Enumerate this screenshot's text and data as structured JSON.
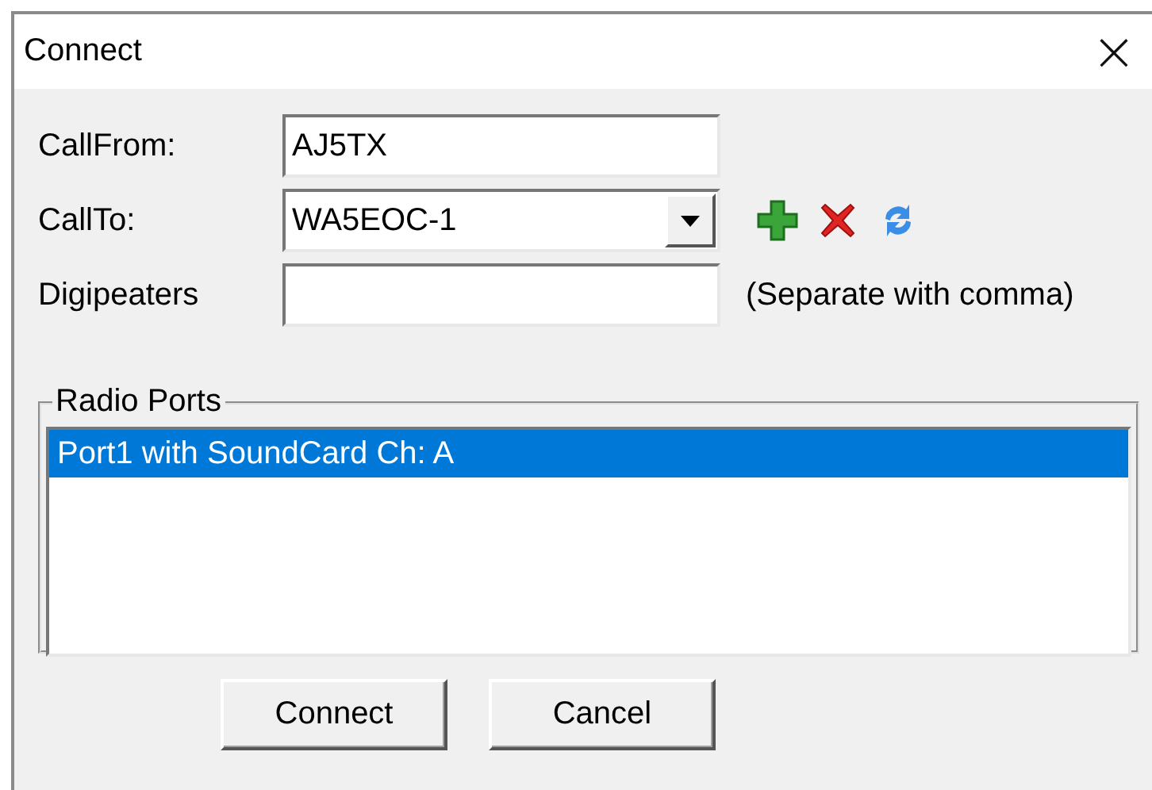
{
  "window": {
    "title": "Connect",
    "close": "×"
  },
  "fields": [
    {
      "label": "CallFrom:",
      "value": "AJ5TX",
      "kind": "text"
    },
    {
      "label": "CallTo:",
      "value": "WA5EOC-1",
      "kind": "combo"
    },
    {
      "label": "Digipeaters",
      "kind": "text",
      "hint": "(Separate with comma)"
    }
  ],
  "radio_ports": {
    "title": "Radio Ports",
    "items": [
      {
        "label": "Port1 with SoundCard Ch: A",
        "selected": true
      }
    ]
  },
  "buttons": [
    "Connect",
    "Cancel"
  ]
}
